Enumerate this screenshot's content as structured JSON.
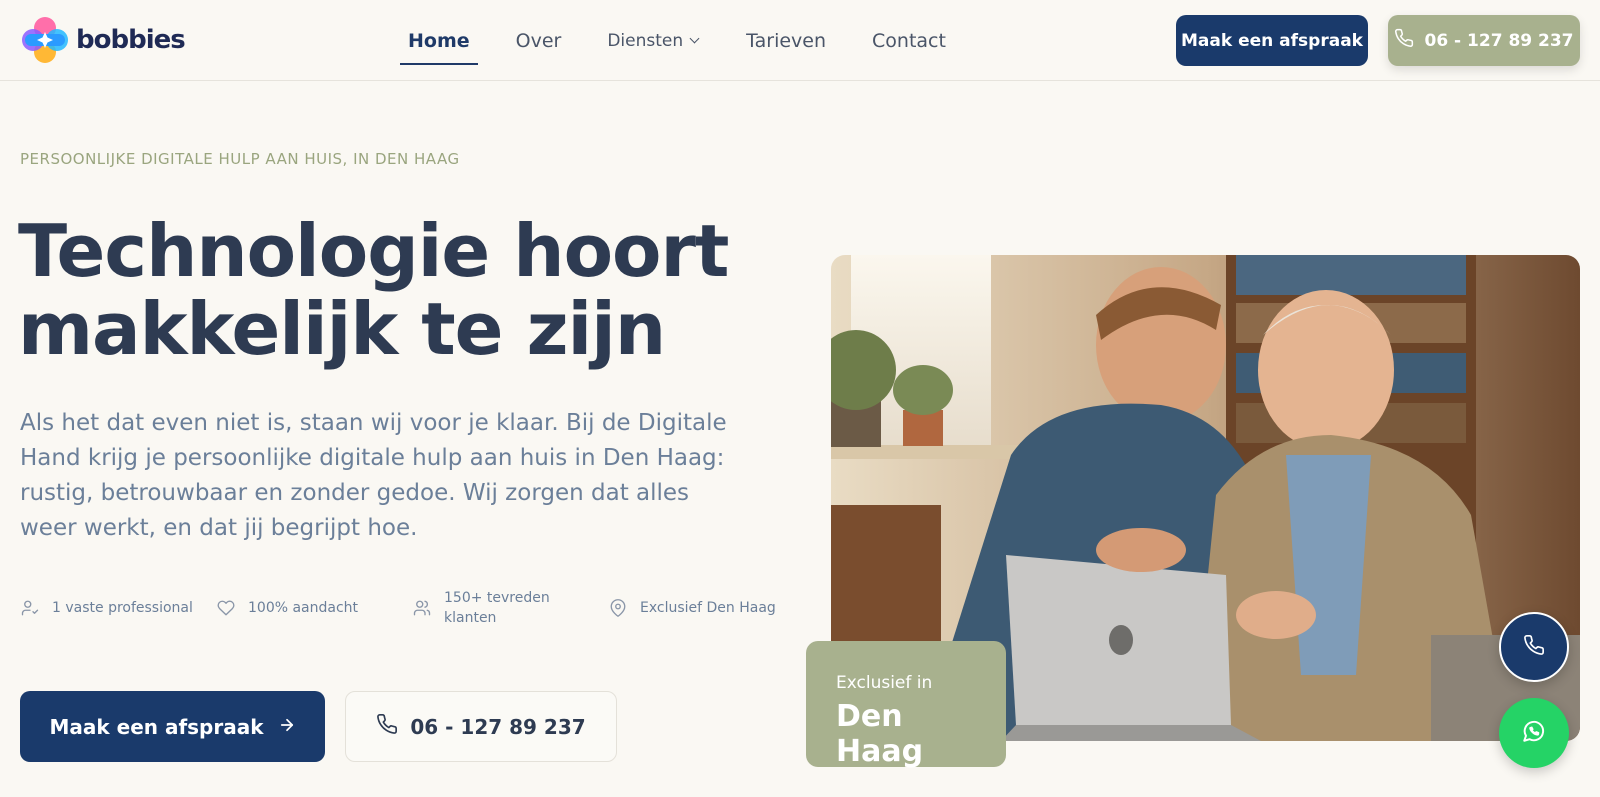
{
  "brand": {
    "name": "bobbies",
    "icon": "bobbies-logo-icon"
  },
  "nav": {
    "items": [
      {
        "label": "Home",
        "active": true
      },
      {
        "label": "Over"
      },
      {
        "label": "Diensten",
        "has_dropdown": true
      },
      {
        "label": "Tarieven"
      },
      {
        "label": "Contact"
      }
    ]
  },
  "header_actions": {
    "appointment_label": "Maak een afspraak",
    "phone_label": "06 - 127 89 237"
  },
  "hero": {
    "eyebrow": "PERSOONLIJKE DIGITALE HULP AAN HUIS, IN DEN HAAG",
    "headline_line1": "Technologie hoort",
    "headline_line2": "makkelijk te zijn",
    "intro": "Als het dat even niet is, staan wij voor je klaar. Bij de Digitale Hand krijg je persoonlijke digitale hulp aan huis in Den Haag: rustig, betrouwbaar en zonder gedoe. Wij zorgen dat alles weer werkt, en dat jij begrijpt hoe.",
    "features": [
      {
        "icon": "user-check-icon",
        "label": "1 vaste professional"
      },
      {
        "icon": "heart-icon",
        "label": "100% aandacht"
      },
      {
        "icon": "users-icon",
        "label": "150+ tevreden klanten"
      },
      {
        "icon": "map-pin-icon",
        "label": "Exclusief Den Haag"
      }
    ],
    "cta_label": "Maak een afspraak",
    "phone_label": "06 - 127 89 237",
    "badge_small": "Exclusief in",
    "badge_big": "Den Haag"
  },
  "colors": {
    "primary": "#1a3a6b",
    "sage": "#a8b18e",
    "background": "#faf8f3",
    "whatsapp": "#25d366"
  }
}
